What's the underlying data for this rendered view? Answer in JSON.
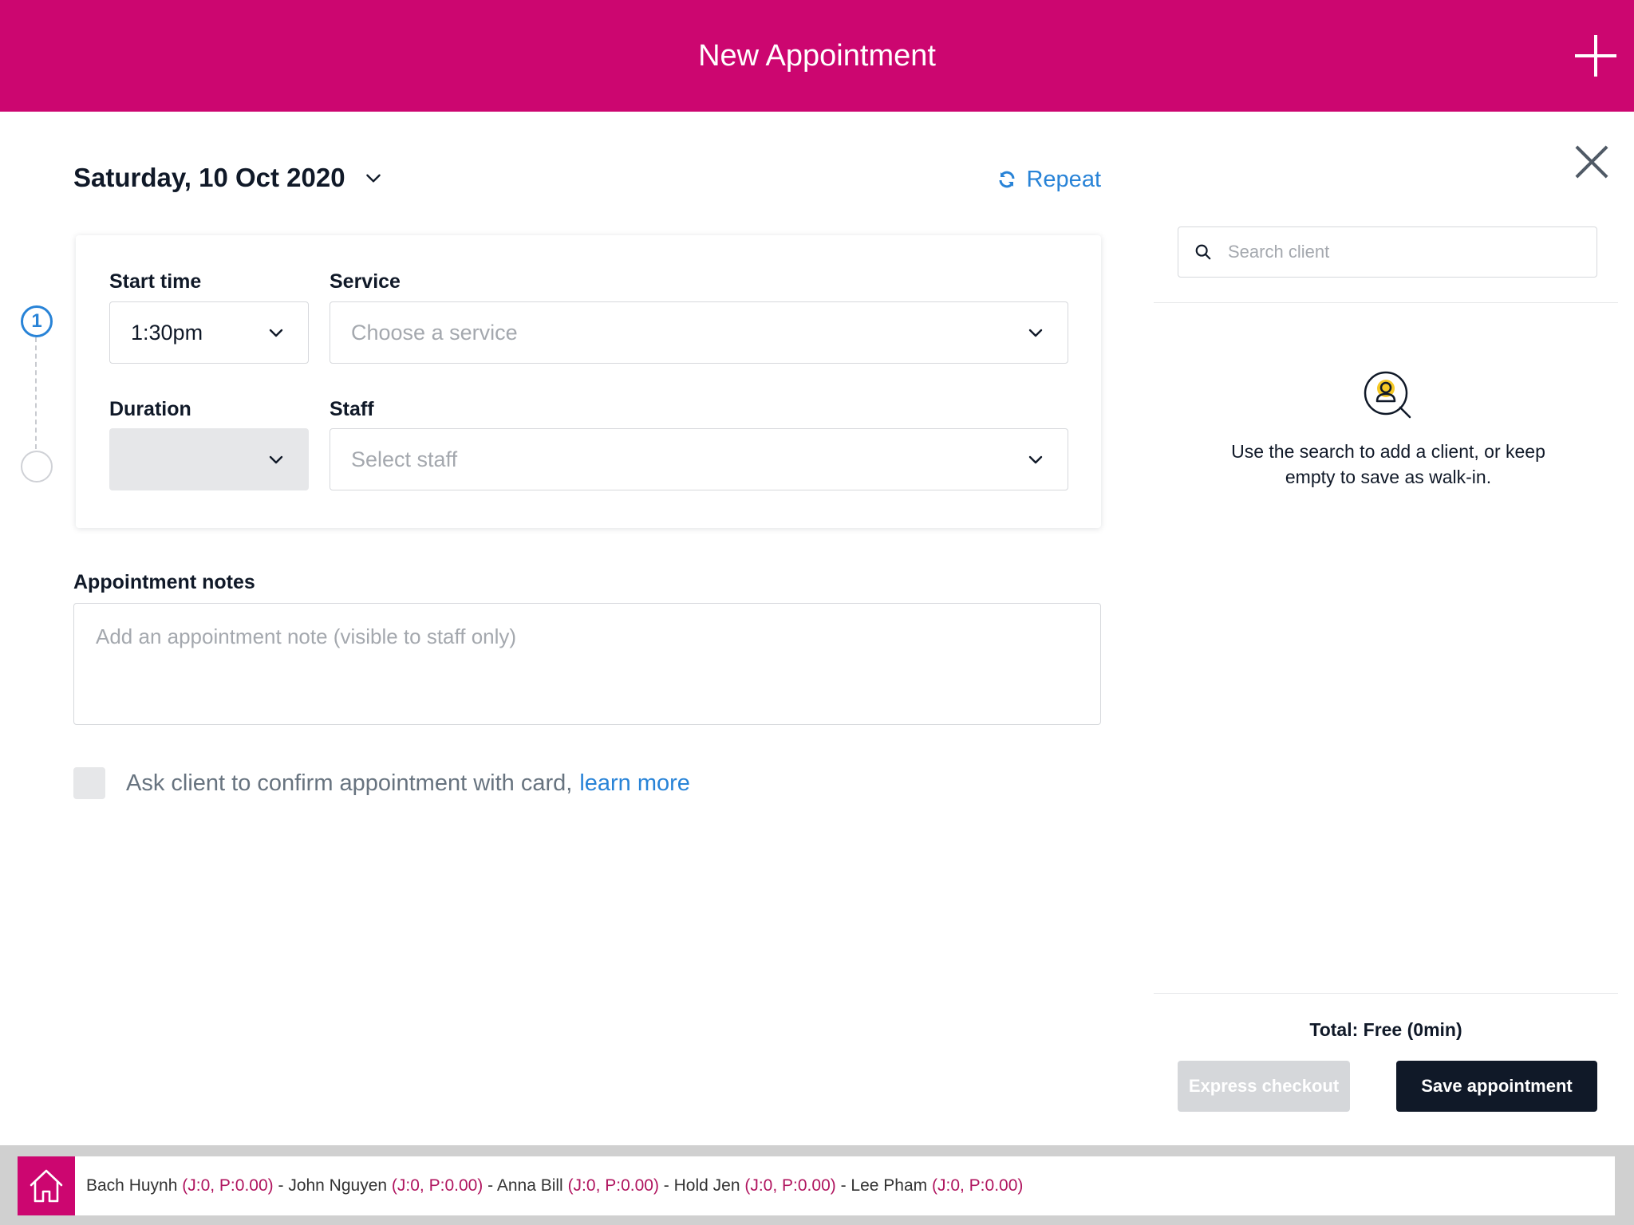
{
  "header": {
    "title": "New Appointment"
  },
  "date": {
    "label": "Saturday, 10 Oct 2020"
  },
  "repeat_label": "Repeat",
  "steps": {
    "step1": "1"
  },
  "form": {
    "start_time_label": "Start time",
    "start_time_value": "1:30pm",
    "service_label": "Service",
    "service_placeholder": "Choose a service",
    "duration_label": "Duration",
    "duration_value": "",
    "staff_label": "Staff",
    "staff_placeholder": "Select staff"
  },
  "notes": {
    "label": "Appointment notes",
    "placeholder": "Add an appointment note (visible to staff only)"
  },
  "confirm": {
    "text": "Ask client to confirm appointment with card,",
    "link": "learn more"
  },
  "client": {
    "search_placeholder": "Search client",
    "hint_line1": "Use the search to add a client, or keep",
    "hint_line2": "empty to save as walk-in."
  },
  "footer": {
    "total": "Total: Free (0min)",
    "express_label": "Express checkout",
    "save_label": "Save appointment"
  },
  "staff_bar": {
    "items": [
      {
        "name": "Bach Huynh",
        "meta": "(J:0, P:0.00)"
      },
      {
        "name": "John Nguyen",
        "meta": "(J:0, P:0.00)"
      },
      {
        "name": "Anna Bill",
        "meta": "(J:0, P:0.00)"
      },
      {
        "name": "Hold Jen",
        "meta": "(J:0, P:0.00)"
      },
      {
        "name": "Lee Pham",
        "meta": "(J:0, P:0.00)"
      }
    ],
    "separator": " - "
  },
  "colors": {
    "brand": "#cc0670",
    "accent": "#2883d7",
    "dark": "#101928"
  },
  "icons": [
    "plus-icon",
    "close-icon",
    "chevron-down-icon",
    "repeat-icon",
    "search-icon",
    "client-search-icon",
    "home-icon"
  ]
}
